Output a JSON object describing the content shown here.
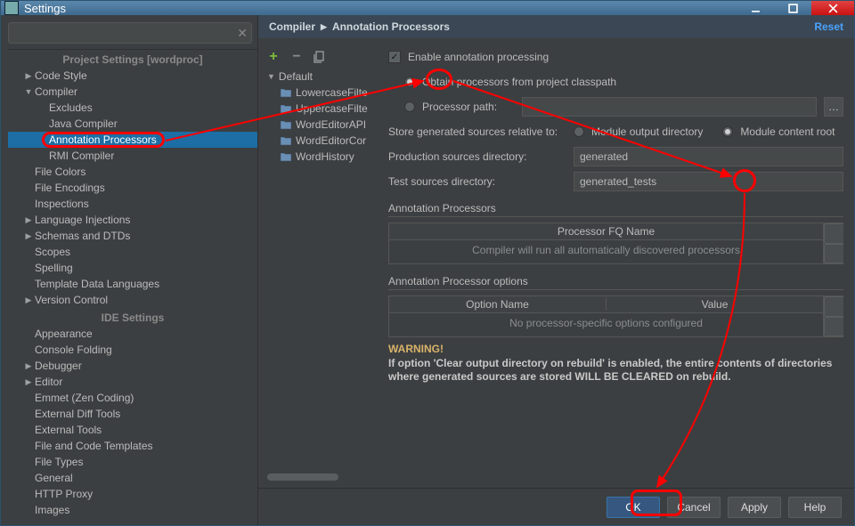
{
  "win": {
    "title": "Settings"
  },
  "search": {
    "placeholder": ""
  },
  "sections": {
    "project": "Project Settings [wordproc]",
    "ide": "IDE Settings"
  },
  "tree": {
    "project_items": [
      {
        "label": "Code Style",
        "exp": "▶",
        "indent": 0
      },
      {
        "label": "Compiler",
        "exp": "▼",
        "indent": 0
      },
      {
        "label": "Excludes",
        "exp": "",
        "indent": 1
      },
      {
        "label": "Java Compiler",
        "exp": "",
        "indent": 1
      },
      {
        "label": "Annotation Processors",
        "exp": "",
        "indent": 1,
        "sel": true
      },
      {
        "label": "RMI Compiler",
        "exp": "",
        "indent": 1
      },
      {
        "label": "File Colors",
        "exp": "",
        "indent": 0
      },
      {
        "label": "File Encodings",
        "exp": "",
        "indent": 0
      },
      {
        "label": "Inspections",
        "exp": "",
        "indent": 0
      },
      {
        "label": "Language Injections",
        "exp": "▶",
        "indent": 0
      },
      {
        "label": "Schemas and DTDs",
        "exp": "▶",
        "indent": 0
      },
      {
        "label": "Scopes",
        "exp": "",
        "indent": 0
      },
      {
        "label": "Spelling",
        "exp": "",
        "indent": 0
      },
      {
        "label": "Template Data Languages",
        "exp": "",
        "indent": 0
      },
      {
        "label": "Version Control",
        "exp": "▶",
        "indent": 0
      }
    ],
    "ide_items": [
      {
        "label": "Appearance"
      },
      {
        "label": "Console Folding"
      },
      {
        "label": "Debugger",
        "exp": "▶"
      },
      {
        "label": "Editor",
        "exp": "▶"
      },
      {
        "label": "Emmet (Zen Coding)"
      },
      {
        "label": "External Diff Tools"
      },
      {
        "label": "External Tools"
      },
      {
        "label": "File and Code Templates"
      },
      {
        "label": "File Types"
      },
      {
        "label": "General"
      },
      {
        "label": "HTTP Proxy"
      },
      {
        "label": "Images"
      }
    ]
  },
  "crumb": {
    "a": "Compiler",
    "b": "Annotation Processors",
    "reset": "Reset"
  },
  "modules": {
    "root": "Default",
    "items": [
      "LowercaseFilte",
      "UppercaseFilte",
      "WordEditorAPI",
      "WordEditorCor",
      "WordHistory"
    ]
  },
  "form": {
    "enable": "Enable annotation processing",
    "obtain": "Obtain processors from project classpath",
    "procpath": "Processor path:",
    "store": "Store generated sources relative to:",
    "modout": "Module output directory",
    "modroot": "Module content root",
    "prod_lbl": "Production sources directory:",
    "prod_val": "generated",
    "test_lbl": "Test sources directory:",
    "test_val": "generated_tests",
    "ap_head": "Annotation Processors",
    "ap_col": "Processor FQ Name",
    "ap_empty": "Compiler will run all automatically discovered processors",
    "opt_head": "Annotation Processor options",
    "opt_col1": "Option Name",
    "opt_col2": "Value",
    "opt_empty": "No processor-specific options configured",
    "warn_t": "WARNING!",
    "warn_b": "If option 'Clear output directory on rebuild' is enabled, the entire contents of directories where generated sources are stored WILL BE CLEARED on rebuild."
  },
  "buttons": {
    "ok": "OK",
    "cancel": "Cancel",
    "apply": "Apply",
    "help": "Help"
  }
}
